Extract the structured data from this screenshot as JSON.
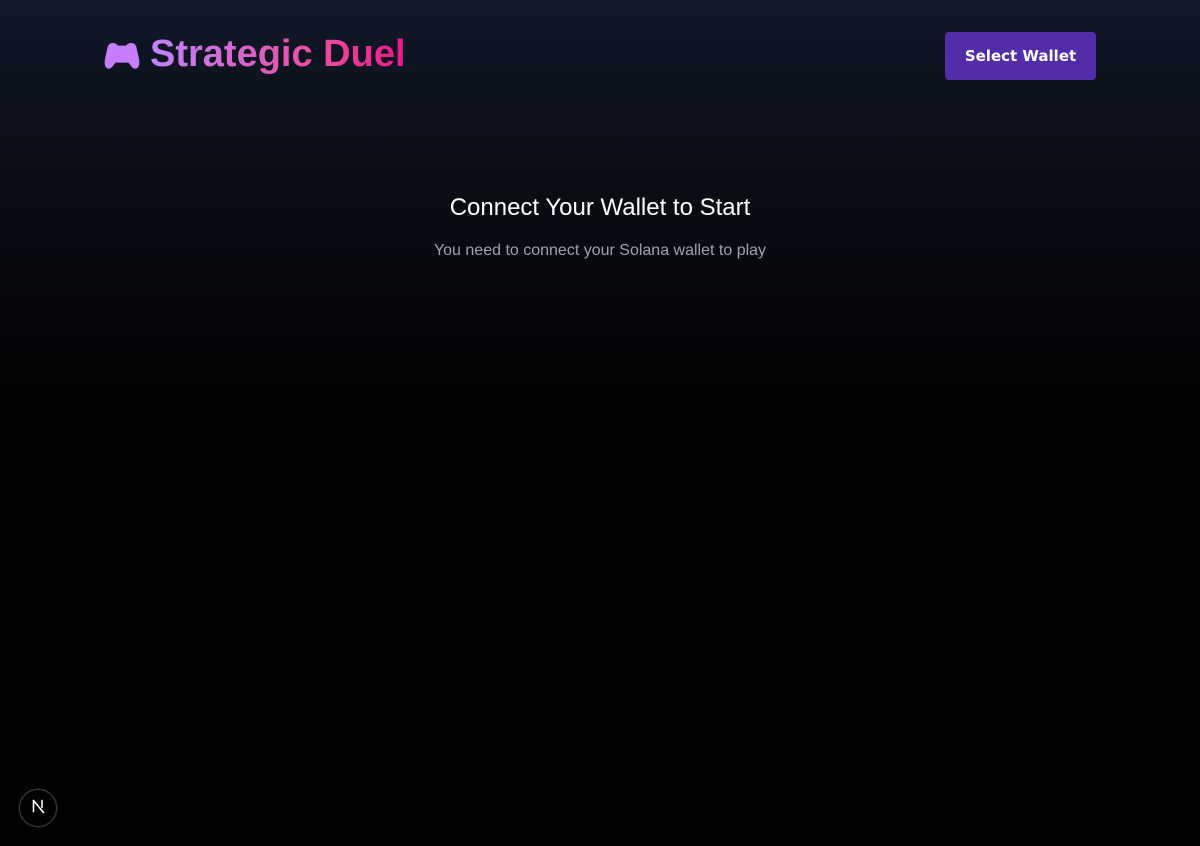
{
  "header": {
    "brand": {
      "icon": "gamepad-icon",
      "title": "Strategic Duel"
    },
    "wallet_button_label": "Select Wallet"
  },
  "main": {
    "heading": "Connect Your Wallet to Start",
    "subtext": "You need to connect your Solana wallet to play"
  },
  "dev_indicator": {
    "icon": "nextjs-logo-icon",
    "letter": "N"
  },
  "colors": {
    "wallet_button": "#512da8",
    "title_gradient_start": "#c084fc",
    "title_gradient_end": "#e8188a",
    "subtext": "#9ca3af"
  }
}
